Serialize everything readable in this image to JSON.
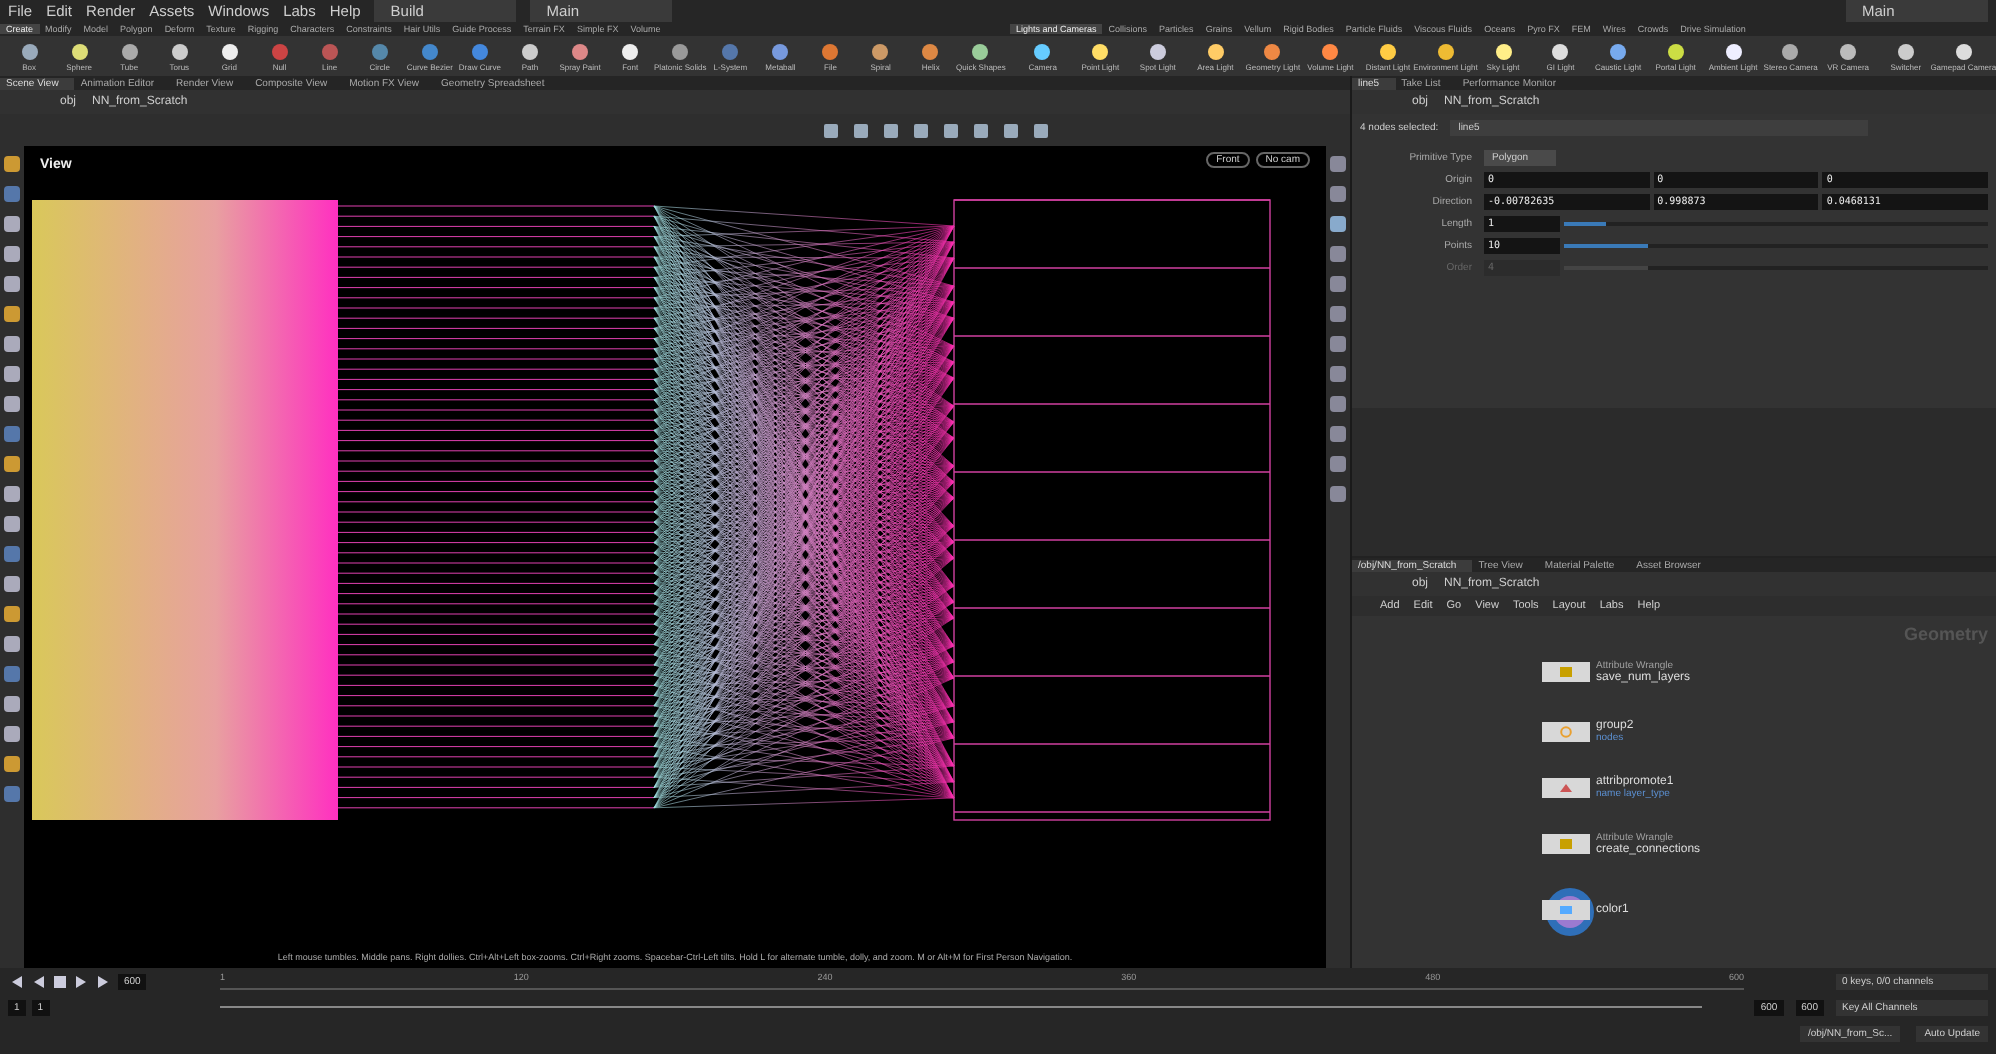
{
  "menu_bar": {
    "items": [
      "File",
      "Edit",
      "Render",
      "Assets",
      "Windows",
      "Labs",
      "Help"
    ],
    "desktops": [
      "Build",
      "Main"
    ],
    "right_desktop": "Main"
  },
  "shelf_left": {
    "tabs": [
      {
        "label": "Create",
        "selected": true
      },
      {
        "label": "Modify",
        "selected": false
      },
      {
        "label": "Model",
        "selected": false
      },
      {
        "label": "Polygon",
        "selected": false
      },
      {
        "label": "Deform",
        "selected": false
      },
      {
        "label": "Texture",
        "selected": false
      },
      {
        "label": "Rigging",
        "selected": false
      },
      {
        "label": "Characters",
        "selected": false
      },
      {
        "label": "Constraints",
        "selected": false
      },
      {
        "label": "Hair Utils",
        "selected": false
      },
      {
        "label": "Guide Process",
        "selected": false
      },
      {
        "label": "Terrain FX",
        "selected": false
      },
      {
        "label": "Simple FX",
        "selected": false
      },
      {
        "label": "Volume",
        "selected": false
      }
    ],
    "tools": [
      "Box",
      "Sphere",
      "Tube",
      "Torus",
      "Grid",
      "Null",
      "Line",
      "Circle",
      "Curve Bezier",
      "Draw Curve",
      "Path",
      "Spray Paint",
      "Font",
      "Platonic Solids",
      "L-System",
      "Metaball",
      "File",
      "Spiral",
      "Helix",
      "Quick Shapes"
    ]
  },
  "shelf_right": {
    "tabs": [
      {
        "label": "Lights and Cameras",
        "selected": true
      },
      {
        "label": "Collisions",
        "selected": false
      },
      {
        "label": "Particles",
        "selected": false
      },
      {
        "label": "Grains",
        "selected": false
      },
      {
        "label": "Vellum",
        "selected": false
      },
      {
        "label": "Rigid Bodies",
        "selected": false
      },
      {
        "label": "Particle Fluids",
        "selected": false
      },
      {
        "label": "Viscous Fluids",
        "selected": false
      },
      {
        "label": "Oceans",
        "selected": false
      },
      {
        "label": "Pyro FX",
        "selected": false
      },
      {
        "label": "FEM",
        "selected": false
      },
      {
        "label": "Wires",
        "selected": false
      },
      {
        "label": "Crowds",
        "selected": false
      },
      {
        "label": "Drive Simulation",
        "selected": false
      }
    ],
    "tools": [
      "Camera",
      "Point Light",
      "Spot Light",
      "Area Light",
      "Geometry Light",
      "Volume Light",
      "Distant Light",
      "Environment Light",
      "Sky Light",
      "GI Light",
      "Caustic Light",
      "Portal Light",
      "Ambient Light",
      "Stereo Camera",
      "VR Camera",
      "Switcher",
      "Gamepad Camera"
    ]
  },
  "scene_pane": {
    "tabs": [
      {
        "label": "Scene View",
        "selected": true
      },
      {
        "label": "Animation Editor",
        "selected": false
      },
      {
        "label": "Render View",
        "selected": false
      },
      {
        "label": "Composite View",
        "selected": false
      },
      {
        "label": "Motion FX View",
        "selected": false
      },
      {
        "label": "Geometry Spreadsheet",
        "selected": false
      }
    ],
    "path": [
      "obj",
      "NN_from_Scratch"
    ],
    "view_label": "View",
    "view_buttons": [
      "Front",
      "No cam"
    ],
    "hint": "Left mouse tumbles. Middle pans. Right dollies. Ctrl+Alt+Left box-zooms. Ctrl+Right zooms. Spacebar-Ctrl-Left tilts. Hold L for alternate tumble, dolly, and zoom. M or Alt+M for First Person Navigation."
  },
  "parameter_pane": {
    "tabs": [
      {
        "label": "line5",
        "selected": true
      },
      {
        "label": "Take List",
        "selected": false
      },
      {
        "label": "Performance Monitor",
        "selected": false
      }
    ],
    "path": [
      "obj",
      "NN_from_Scratch"
    ],
    "selection_label": "4 nodes selected:",
    "node_name": "line5",
    "params": [
      {
        "kind": "menu",
        "label": "Primitive Type",
        "value": "Polygon",
        "disabled": false
      },
      {
        "kind": "vector",
        "label": "Origin",
        "values": [
          "0",
          "0",
          "0"
        ],
        "disabled": false
      },
      {
        "kind": "vector",
        "label": "Direction",
        "values": [
          "-0.00782635",
          "0.998873",
          "0.0468131"
        ],
        "disabled": false
      },
      {
        "kind": "slider",
        "label": "Length",
        "value": "1",
        "level": 0.1,
        "disabled": false
      },
      {
        "kind": "slider",
        "label": "Points",
        "value": "10",
        "level": 0.2,
        "disabled": false
      },
      {
        "kind": "slider",
        "label": "Order",
        "value": "4",
        "level": 0.2,
        "disabled": true
      }
    ]
  },
  "network_pane": {
    "tabs": [
      {
        "label": "/obj/NN_from_Scratch",
        "selected": true
      },
      {
        "label": "Tree View",
        "selected": false
      },
      {
        "label": "Material Palette",
        "selected": false
      },
      {
        "label": "Asset Browser",
        "selected": false
      }
    ],
    "path": [
      "obj",
      "NN_from_Scratch"
    ],
    "menu": [
      "Add",
      "Edit",
      "Go",
      "View",
      "Tools",
      "Layout",
      "Labs",
      "Help"
    ],
    "context_label": "Geometry",
    "nodes": [
      {
        "kind": "wrangle",
        "type_label": "Attribute Wrangle",
        "name": "save_num_layers"
      },
      {
        "kind": "group",
        "name": "group2",
        "sublabel": "nodes"
      },
      {
        "kind": "promote",
        "name": "attribpromote1",
        "sublabel": "name layer_type"
      },
      {
        "kind": "wrangle",
        "type_label": "Attribute Wrangle",
        "name": "create_connections"
      },
      {
        "kind": "color",
        "name": "color1"
      }
    ]
  },
  "timeline": {
    "frame": "600",
    "ticks": [
      "1",
      "120",
      "240",
      "360",
      "480",
      "600"
    ],
    "range_start": "1",
    "range_current": "1",
    "range_end": "600",
    "range_end_total": "600",
    "keys_label": "0 keys, 0/0 channels",
    "key_button": "Key All Channels"
  },
  "status_bar": {
    "path": "/obj/NN_from_Sc...",
    "update_mode": "Auto Update"
  }
}
